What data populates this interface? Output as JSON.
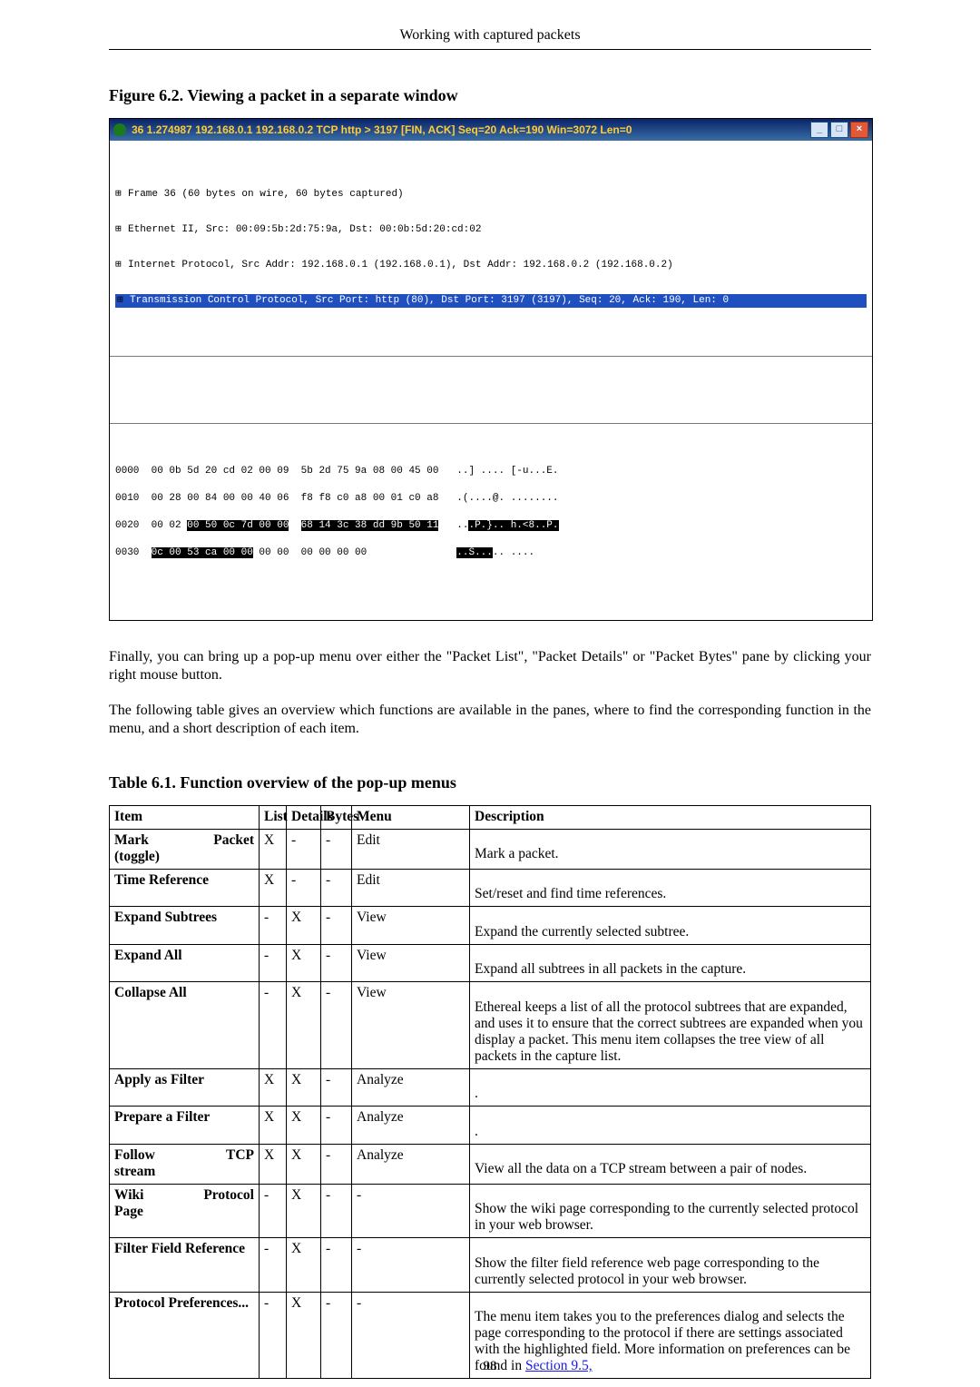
{
  "running_header": "Working with captured packets",
  "page_number": "98",
  "figure": {
    "caption": "Figure 6.2. Viewing a packet in a separate window",
    "window_title": "36 1.274987 192.168.0.1 192.168.0.2 TCP http > 3197 [FIN, ACK] Seq=20 Ack=190 Win=3072 Len=0",
    "win_min": "_",
    "win_max": "□",
    "win_close": "×",
    "tree": {
      "l1": "Frame 36 (60 bytes on wire, 60 bytes captured)",
      "l2": "Ethernet II, Src: 00:09:5b:2d:75:9a, Dst: 00:0b:5d:20:cd:02",
      "l3": "Internet Protocol, Src Addr: 192.168.0.1 (192.168.0.1), Dst Addr: 192.168.0.2 (192.168.0.2)",
      "l4": "Transmission Control Protocol, Src Port: http (80), Dst Port: 3197 (3197), Seq: 20, Ack: 190, Len: 0"
    },
    "hex": {
      "r0_off": "0000",
      "r0_a": "00 0b 5d 20 cd 02 00 09",
      "r0_b": "5b 2d 75 9a 08 00 45 00",
      "r0_t": "..] .... [-u...E.",
      "r1_off": "0010",
      "r1_a": "00 28 00 84 00 00 40 06",
      "r1_b": "f8 f8 c0 a8 00 01 c0 a8",
      "r1_t": ".(....@. ........",
      "r2_off": "0020",
      "r2_pre": "00 02 ",
      "r2_hl1": "00 50 0c 7d 00 00",
      "r2_mid": "  ",
      "r2_hl2": "68 14 3c 38 dd 9b 50 11",
      "r2_t_pre": "..",
      "r2_t_hl": ".P.}.. h.<8..P.",
      "r3_off": "0030",
      "r3_hl": "0c 00 53 ca 00 00",
      "r3_rest": " 00 00  00 00 00 00",
      "r3_t_hl": "..S...",
      "r3_t_rest": ".. ...."
    }
  },
  "para1": "Finally, you can bring up a pop-up menu over either the \"Packet List\", \"Packet Details\" or \"Packet Bytes\" pane by clicking your right mouse button.",
  "para2": "The following table gives an overview which functions are available in the panes, where to find the corresponding function in the menu, and a short description of each item.",
  "table": {
    "caption": "Table 6.1. Function overview of the pop-up menus",
    "head": {
      "item": "Item",
      "list": "List",
      "details": "Details",
      "bytes": "Bytes",
      "menu": "Menu",
      "desc": "Description"
    },
    "rows": [
      {
        "item_l": "Mark",
        "item_r": "Packet",
        "item_b": "(toggle)",
        "list": "X",
        "det": "-",
        "byt": "-",
        "menu": "Edit",
        "desc": "Mark a packet."
      },
      {
        "item": "Time Reference",
        "list": "X",
        "det": "-",
        "byt": "-",
        "menu": "Edit",
        "desc": "Set/reset and find time references."
      },
      {
        "item": "Expand Subtrees",
        "list": "-",
        "det": "X",
        "byt": "-",
        "menu": "View",
        "desc": "Expand the currently selected subtree."
      },
      {
        "item": "Expand All",
        "list": "-",
        "det": "X",
        "byt": "-",
        "menu": "View",
        "desc": "Expand all subtrees in all packets in the capture."
      },
      {
        "item": "Collapse All",
        "list": "-",
        "det": "X",
        "byt": "-",
        "menu": "View",
        "desc": "Ethereal keeps a list of all the protocol subtrees that are expanded, and uses it to ensure that the correct subtrees are expanded when you display a packet. This menu item collapses the tree view of all packets in the capture list."
      },
      {
        "item": "Apply as Filter",
        "list": "X",
        "det": "X",
        "byt": "-",
        "menu": "Analyze",
        "desc": "."
      },
      {
        "item": "Prepare a Filter",
        "list": "X",
        "det": "X",
        "byt": "-",
        "menu": "Analyze",
        "desc": "."
      },
      {
        "item_l": "Follow",
        "item_r": "TCP",
        "item_b": "stream",
        "list": "X",
        "det": "X",
        "byt": "-",
        "menu": "Analyze",
        "desc": "View all the data on a TCP stream between a pair of nodes."
      },
      {
        "item_l": "Wiki",
        "item_r": "Protocol",
        "item_b": "Page",
        "list": "-",
        "det": "X",
        "byt": "-",
        "menu": "-",
        "desc": "Show the wiki page corresponding to the currently selected protocol in your web browser."
      },
      {
        "item": "Filter Field Reference",
        "list": "-",
        "det": "X",
        "byt": "-",
        "menu": "-",
        "desc": "Show the filter field reference web page corresponding to the currently selected protocol in your web browser."
      },
      {
        "item": "Protocol Preferences...",
        "list": "-",
        "det": "X",
        "byt": "-",
        "menu": "-",
        "desc_pre": "The menu item takes you to the preferences dialog and selects the page corresponding to the protocol if there are settings associated with the highlighted field. More information on preferences can be found in ",
        "desc_link": "Section 9.5,",
        "desc_post": ""
      }
    ]
  }
}
